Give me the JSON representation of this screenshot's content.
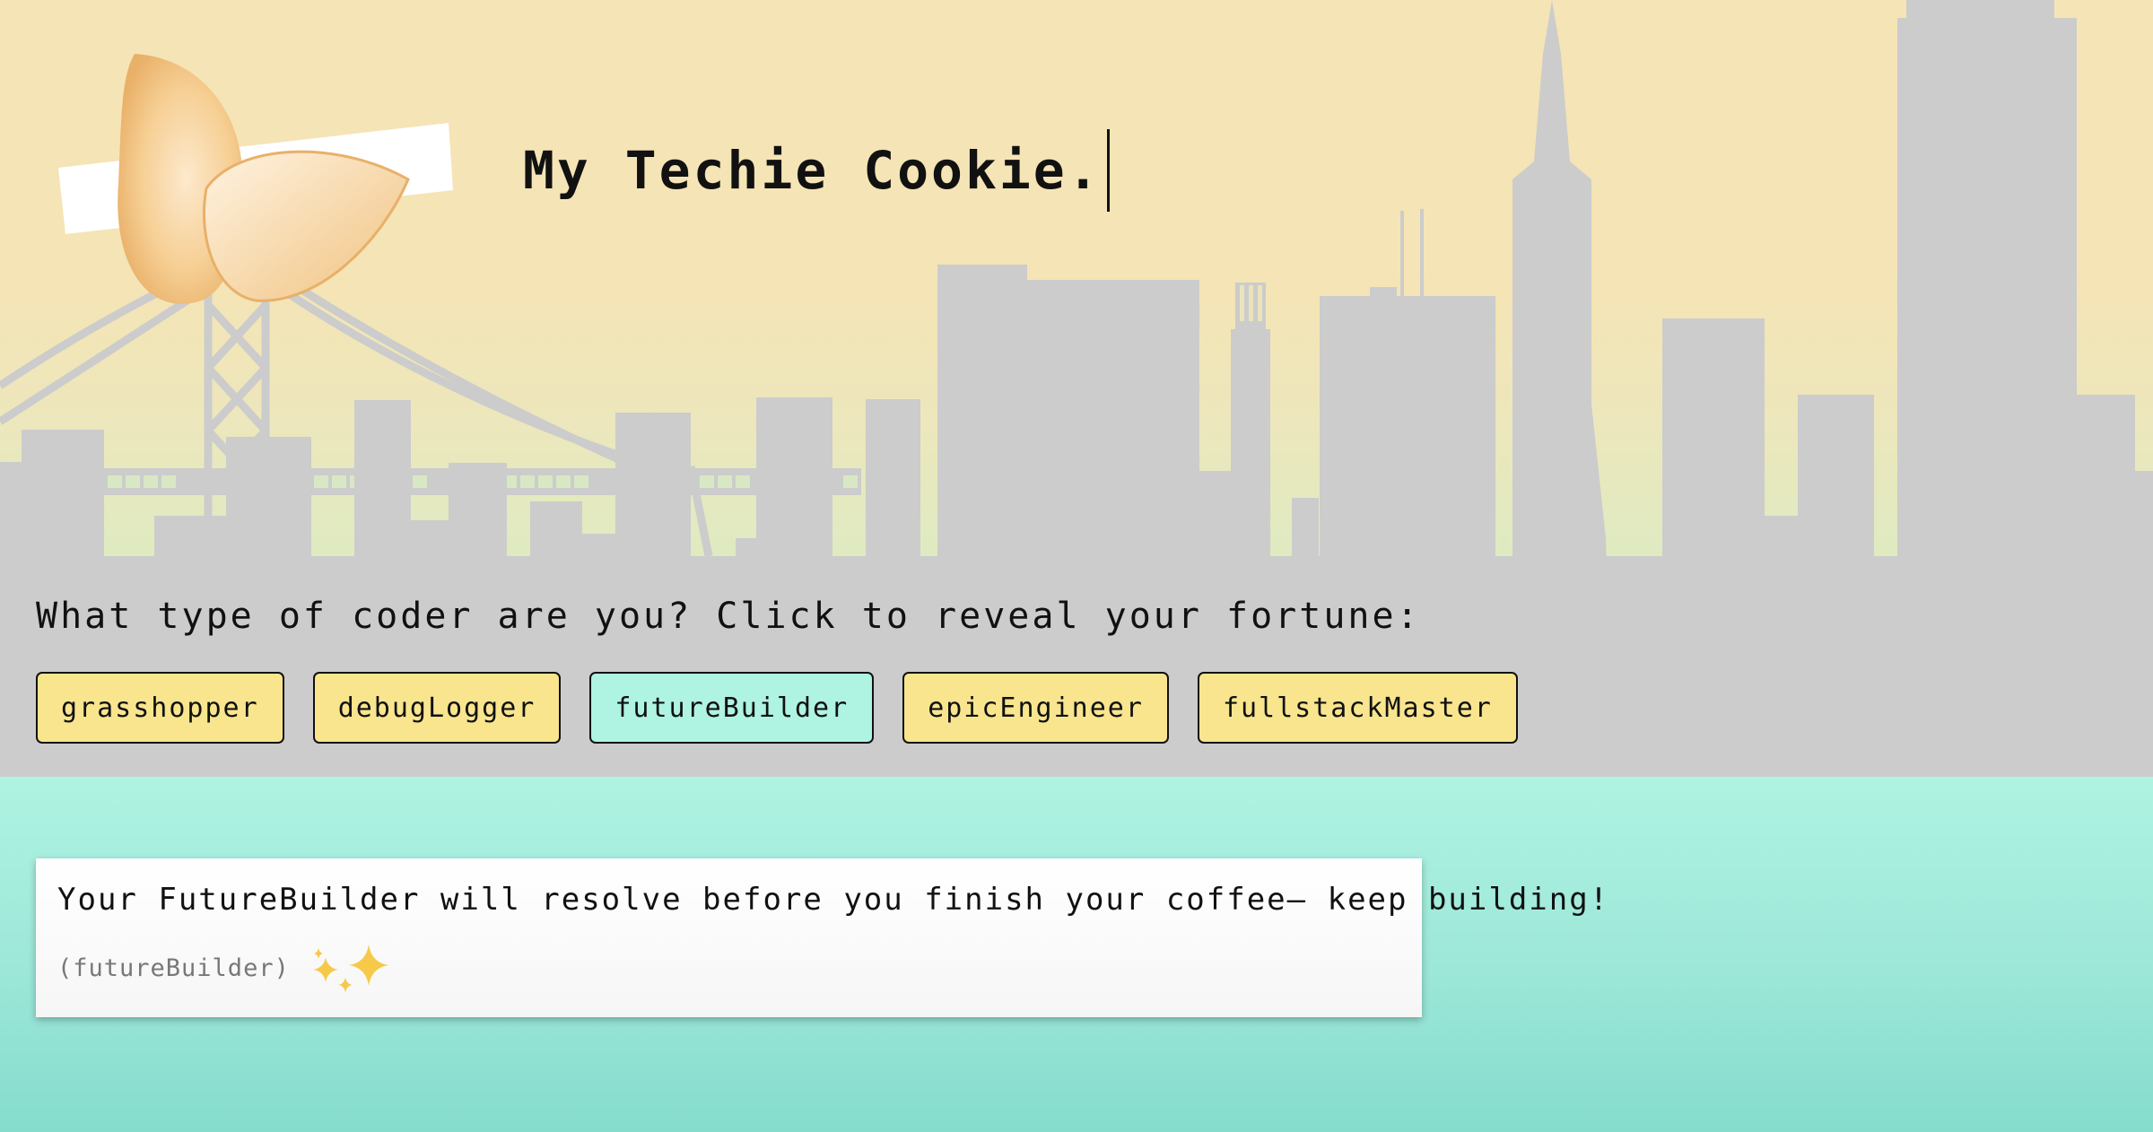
{
  "header": {
    "title": "My Techie Cookie."
  },
  "main": {
    "prompt": "What type of coder are you? Click to reveal your fortune:",
    "coder_types": [
      {
        "label": "grasshopper",
        "selected": false
      },
      {
        "label": "debugLogger",
        "selected": false
      },
      {
        "label": "futureBuilder",
        "selected": true
      },
      {
        "label": "epicEngineer",
        "selected": false
      },
      {
        "label": "fullstackMaster",
        "selected": false
      }
    ]
  },
  "fortune": {
    "message": "Your FutureBuilder will resolve before you finish your coffee— keep building!",
    "tag": "(futureBuilder)",
    "decoration_icon": "sparkles-icon"
  },
  "colors": {
    "button": "#f8e58e",
    "button_selected": "#aff3e2",
    "skyline": "#cccccc",
    "sky_top": "#f5e4b5",
    "sky_bottom": "#cde9c2",
    "water_top": "#aff3e2",
    "water_bottom": "#85dccd"
  }
}
